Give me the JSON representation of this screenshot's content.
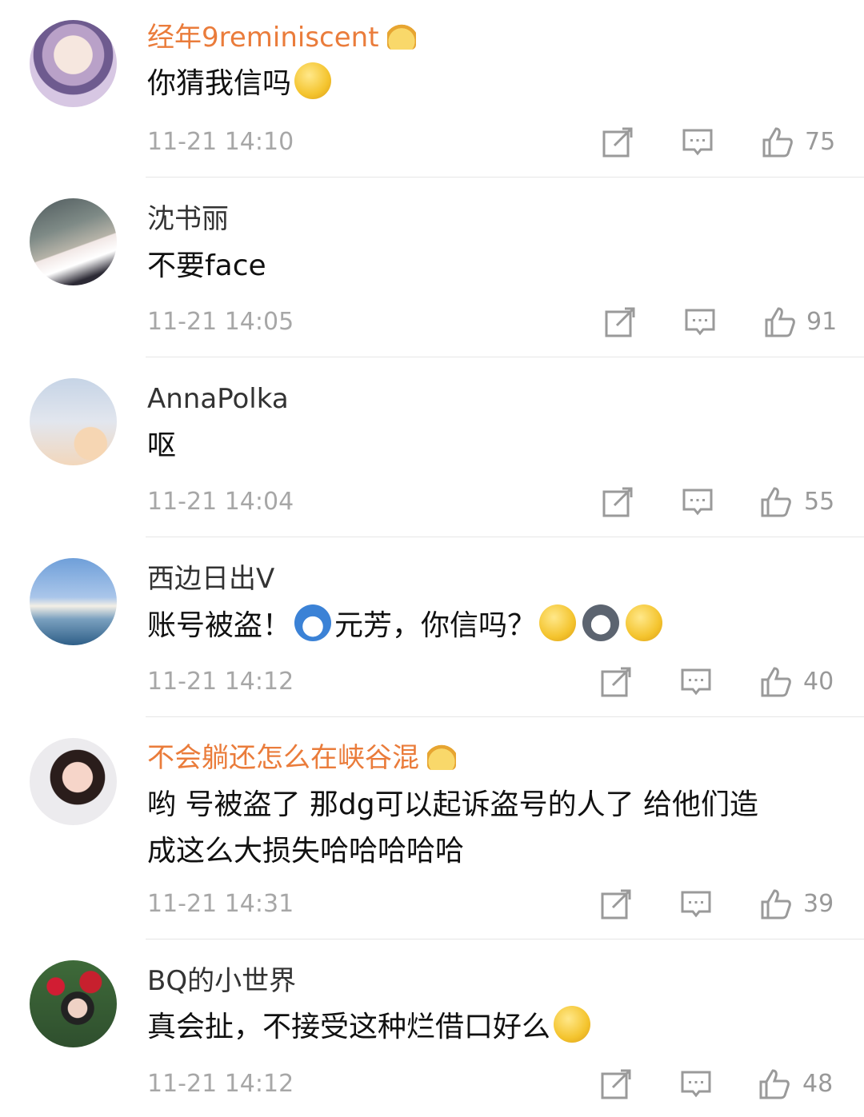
{
  "comments": [
    {
      "username": "经年9reminiscent",
      "vip": true,
      "text": "你猜我信吗",
      "time": "11-21 14:10",
      "likes": "75"
    },
    {
      "username": "沈书丽",
      "vip": false,
      "text": "不要face",
      "time": "11-21 14:05",
      "likes": "91"
    },
    {
      "username": "AnnaPolka",
      "vip": false,
      "text": "呕",
      "time": "11-21 14:04",
      "likes": "55"
    },
    {
      "username": "西边日出V",
      "vip": false,
      "text_a": "账号被盗！",
      "text_b": "元芳，你信吗？",
      "time": "11-21 14:12",
      "likes": "40"
    },
    {
      "username": "不会躺还怎么在峡谷混",
      "vip": true,
      "text_line1": "哟 号被盗了 那dg可以起诉盗号的人了 给他们造",
      "text_line2": "成这么大损失哈哈哈哈哈",
      "time": "11-21 14:31",
      "likes": "39"
    },
    {
      "username": "BQ的小世界",
      "vip": false,
      "text": "真会扯，不接受这种烂借口好么",
      "time": "11-21 14:12",
      "likes": "48"
    }
  ],
  "colors": {
    "vip_name": "#ea7c3b",
    "name": "#333333",
    "time": "#a7a7a7",
    "icon": "#9a9a9a",
    "divider": "#e6e6e6"
  },
  "icons": {
    "share": "share-icon",
    "reply": "comment-icon",
    "like": "thumbs-up-icon",
    "vip": "crown-icon"
  }
}
